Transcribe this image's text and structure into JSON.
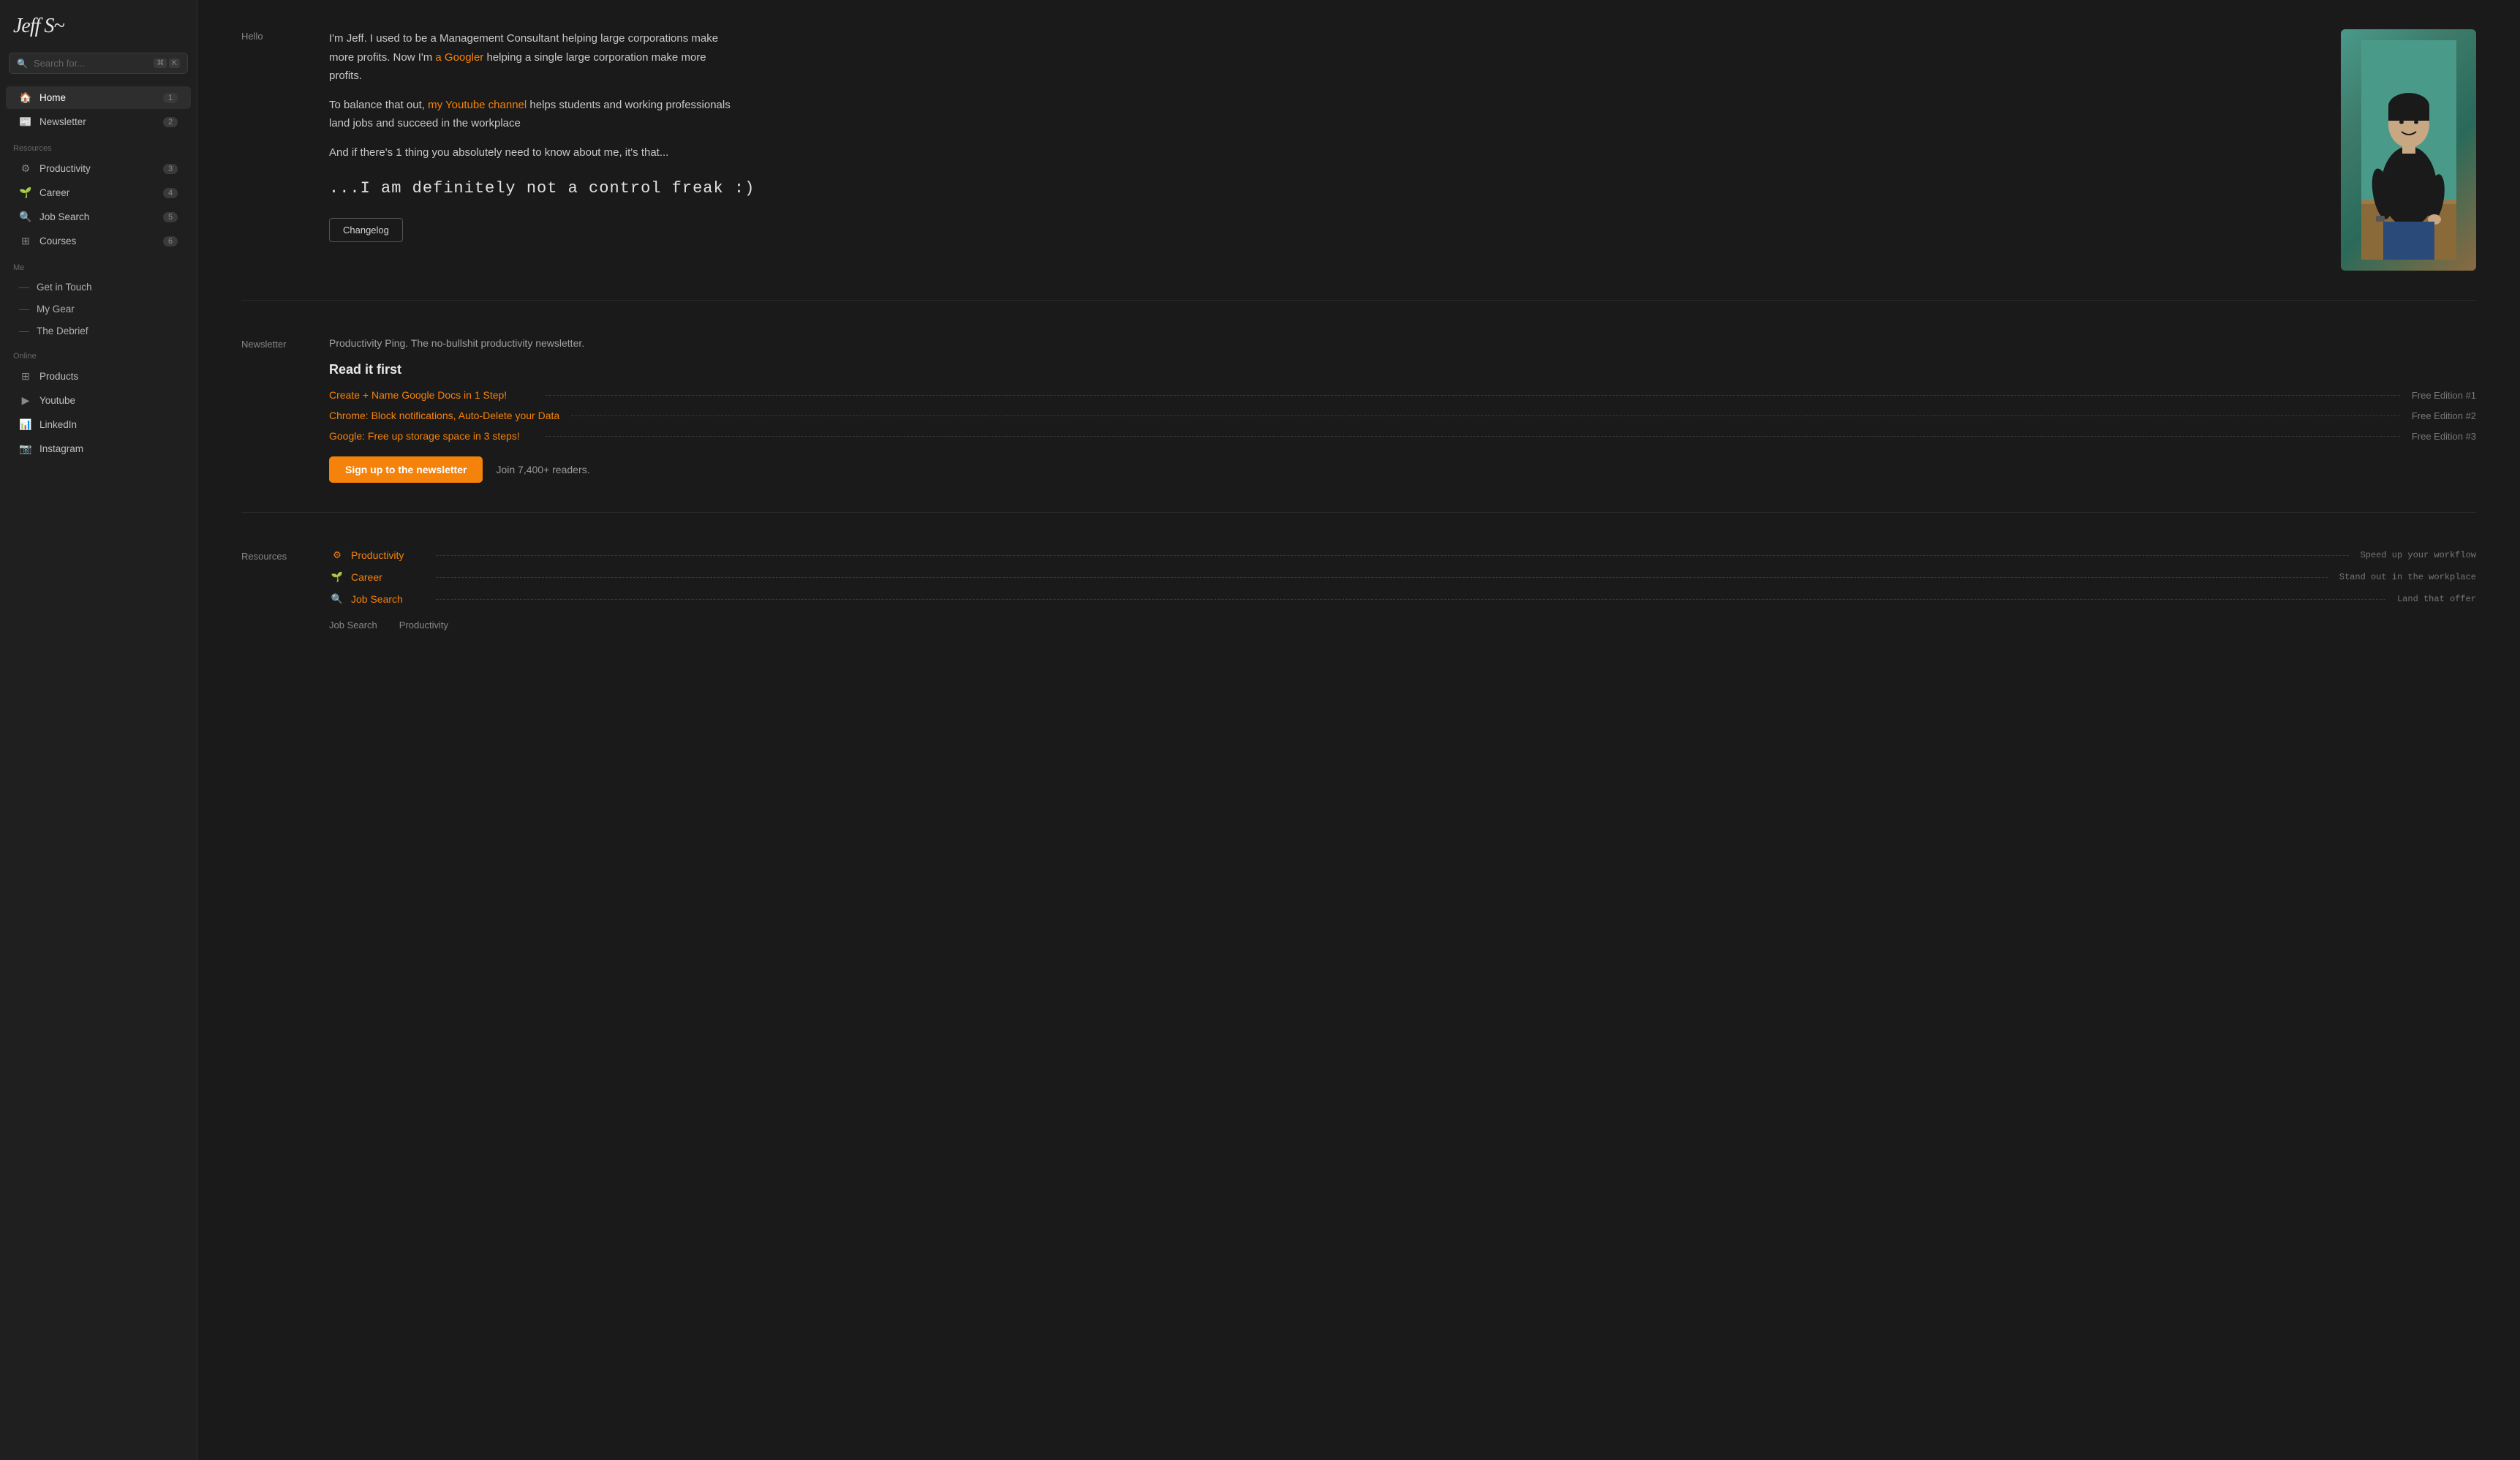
{
  "sidebar": {
    "logo": "Jeff S~",
    "search_placeholder": "Search for...",
    "kbd1": "⌘",
    "kbd2": "K",
    "main_nav": [
      {
        "id": "home",
        "icon": "🏠",
        "label": "Home",
        "badge": "1",
        "active": true
      },
      {
        "id": "newsletter",
        "icon": "📰",
        "label": "Newsletter",
        "badge": "2",
        "active": false
      }
    ],
    "resources_header": "Resources",
    "resources_nav": [
      {
        "id": "productivity",
        "icon": "⚙",
        "label": "Productivity",
        "badge": "3"
      },
      {
        "id": "career",
        "icon": "🌱",
        "label": "Career",
        "badge": "4"
      },
      {
        "id": "job-search",
        "icon": "🔍",
        "label": "Job Search",
        "badge": "5"
      },
      {
        "id": "courses",
        "icon": "⊞",
        "label": "Courses",
        "badge": "6"
      }
    ],
    "me_header": "Me",
    "me_nav": [
      {
        "id": "get-in-touch",
        "label": "Get in Touch"
      },
      {
        "id": "my-gear",
        "label": "My Gear"
      },
      {
        "id": "the-debrief",
        "label": "The Debrief"
      }
    ],
    "online_header": "Online",
    "online_nav": [
      {
        "id": "products",
        "icon": "⊞",
        "label": "Products"
      },
      {
        "id": "youtube",
        "icon": "▶",
        "label": "Youtube"
      },
      {
        "id": "linkedin",
        "icon": "📊",
        "label": "LinkedIn"
      },
      {
        "id": "instagram",
        "icon": "📷",
        "label": "Instagram"
      }
    ]
  },
  "main": {
    "hello_section": {
      "label": "Hello",
      "paragraph1_pre": "I'm Jeff. I used to be a Management Consultant helping large corporations make more profits. Now I'm ",
      "googler_text": "a Googler",
      "paragraph1_post": " helping a single large corporation make more profits.",
      "paragraph2_pre": "To balance that out, ",
      "youtube_link_text": "my Youtube channel",
      "paragraph2_post": " helps students and working professionals land jobs and succeed in the workplace",
      "paragraph3": "And if there's 1 thing you absolutely need to know about me, it's that...",
      "quote": "...I am definitely not a control freak :)",
      "changelog_btn": "Changelog"
    },
    "newsletter_section": {
      "label": "Newsletter",
      "description": "Productivity Ping. The no-bullshit productivity newsletter.",
      "read_first_title": "Read it first",
      "editions": [
        {
          "title": "Create + Name Google Docs in 1 Step!",
          "label": "Free Edition #1"
        },
        {
          "title": "Chrome: Block notifications, Auto-Delete your Data",
          "label": "Free Edition #2"
        },
        {
          "title": "Google: Free up storage space in 3 steps!",
          "label": "Free Edition #3"
        }
      ],
      "signup_btn": "Sign up to the newsletter",
      "signup_note": "Join 7,400+ readers."
    },
    "resources_section": {
      "label": "Resources",
      "resources": [
        {
          "icon": "⚙",
          "title": "Productivity",
          "desc": "Speed up your workflow"
        },
        {
          "icon": "🌱",
          "title": "Career",
          "desc": "Stand out in the workplace"
        },
        {
          "icon": "🔍",
          "title": "Job Search",
          "desc": "Land that offer"
        }
      ]
    },
    "footer_links": [
      {
        "label": "Job Search"
      },
      {
        "label": "Productivity"
      }
    ]
  }
}
